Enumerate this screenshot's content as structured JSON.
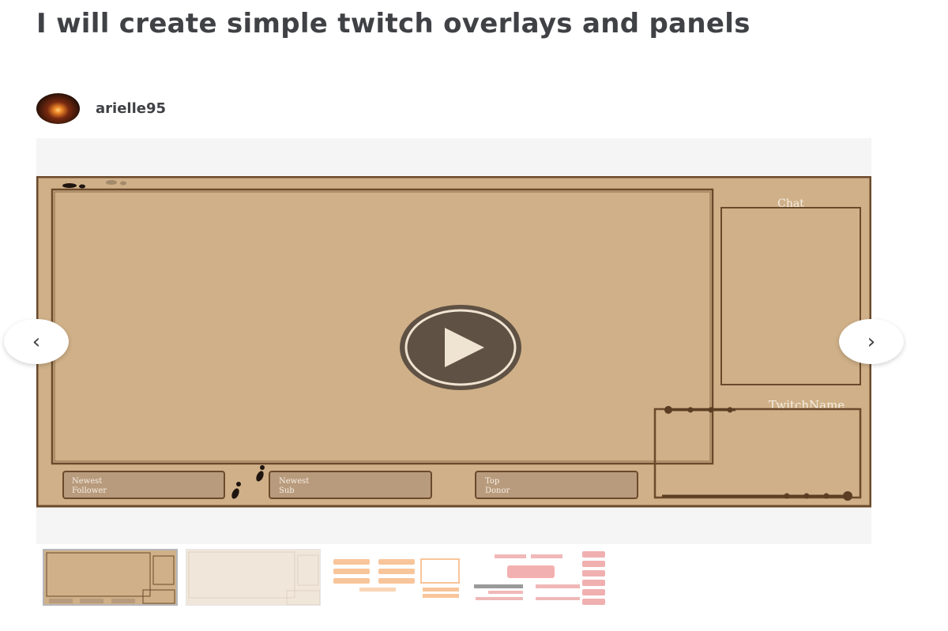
{
  "gig": {
    "title": "I will create simple twitch overlays and panels"
  },
  "seller": {
    "name": "arielle95",
    "avatar_icon": "sunset-avatar"
  },
  "media": {
    "overlay_labels": {
      "chat": "Chat",
      "twitch_name": "TwitchName",
      "newest_follower_1": "Newest",
      "newest_follower_2": "Follower",
      "newest_sub_1": "Newest",
      "newest_sub_2": "Sub",
      "top_donor_1": "Top",
      "top_donor_2": "Donor"
    },
    "colors": {
      "overlay_bg": "#cfb088",
      "overlay_border": "#6a4a2b",
      "label_box": "#b89a7c",
      "label_text": "#f6eee2",
      "play_bg": "#5f5143",
      "play_icon": "#efe3d1"
    },
    "play_icon": "play-icon",
    "prev_icon": "chevron-left-icon",
    "next_icon": "chevron-right-icon",
    "prev_glyph": "‹",
    "next_glyph": "›"
  },
  "thumbnails": [
    {
      "name": "thumbnail-1",
      "active": true
    },
    {
      "name": "thumbnail-2",
      "active": false
    },
    {
      "name": "thumbnail-3",
      "active": false
    },
    {
      "name": "thumbnail-4",
      "active": false
    }
  ]
}
